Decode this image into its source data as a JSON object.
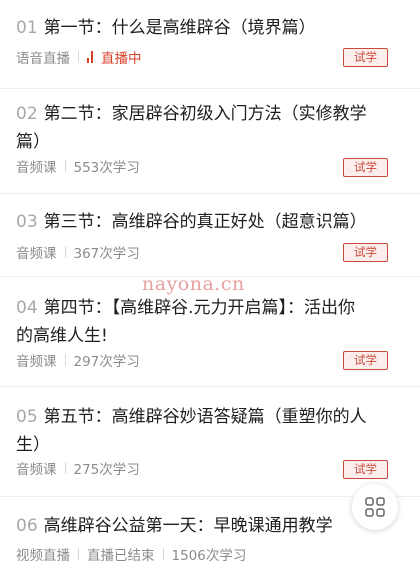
{
  "lessons": [
    {
      "num": "01",
      "title": "第一节：什么是高维辟谷（境界篇）",
      "type": "语音直播",
      "status": "直播中",
      "button": "试学"
    },
    {
      "num": "02",
      "title": "第二节：家居辟谷初级入门方法（实修教学篇）",
      "type": "音频课",
      "status": "553次学习",
      "button": "试学"
    },
    {
      "num": "03",
      "title": "第三节：高维辟谷的真正好处（超意识篇）",
      "type": "音频课",
      "status": "367次学习",
      "button": "试学"
    },
    {
      "num": "04",
      "title": "第四节：【高维辟谷.元力开启篇】：活出你的高维人生!",
      "type": "音频课",
      "status": "297次学习",
      "button": "试学"
    },
    {
      "num": "05",
      "title": "第五节：高维辟谷妙语答疑篇（重塑你的人生）",
      "type": "音频课",
      "status": "275次学习",
      "button": "试学"
    },
    {
      "num": "06",
      "title": "高维辟谷公益第一天：早晚课通用教学",
      "type": "视频直播",
      "status": "直播已结束",
      "extra": "1506次学习"
    }
  ],
  "watermark": "nayona.cn",
  "icons": {
    "live": "live-bars-icon",
    "fab": "grid-menu-icon"
  },
  "colors": {
    "accent": "#c84a3b",
    "live": "#d9402b"
  }
}
